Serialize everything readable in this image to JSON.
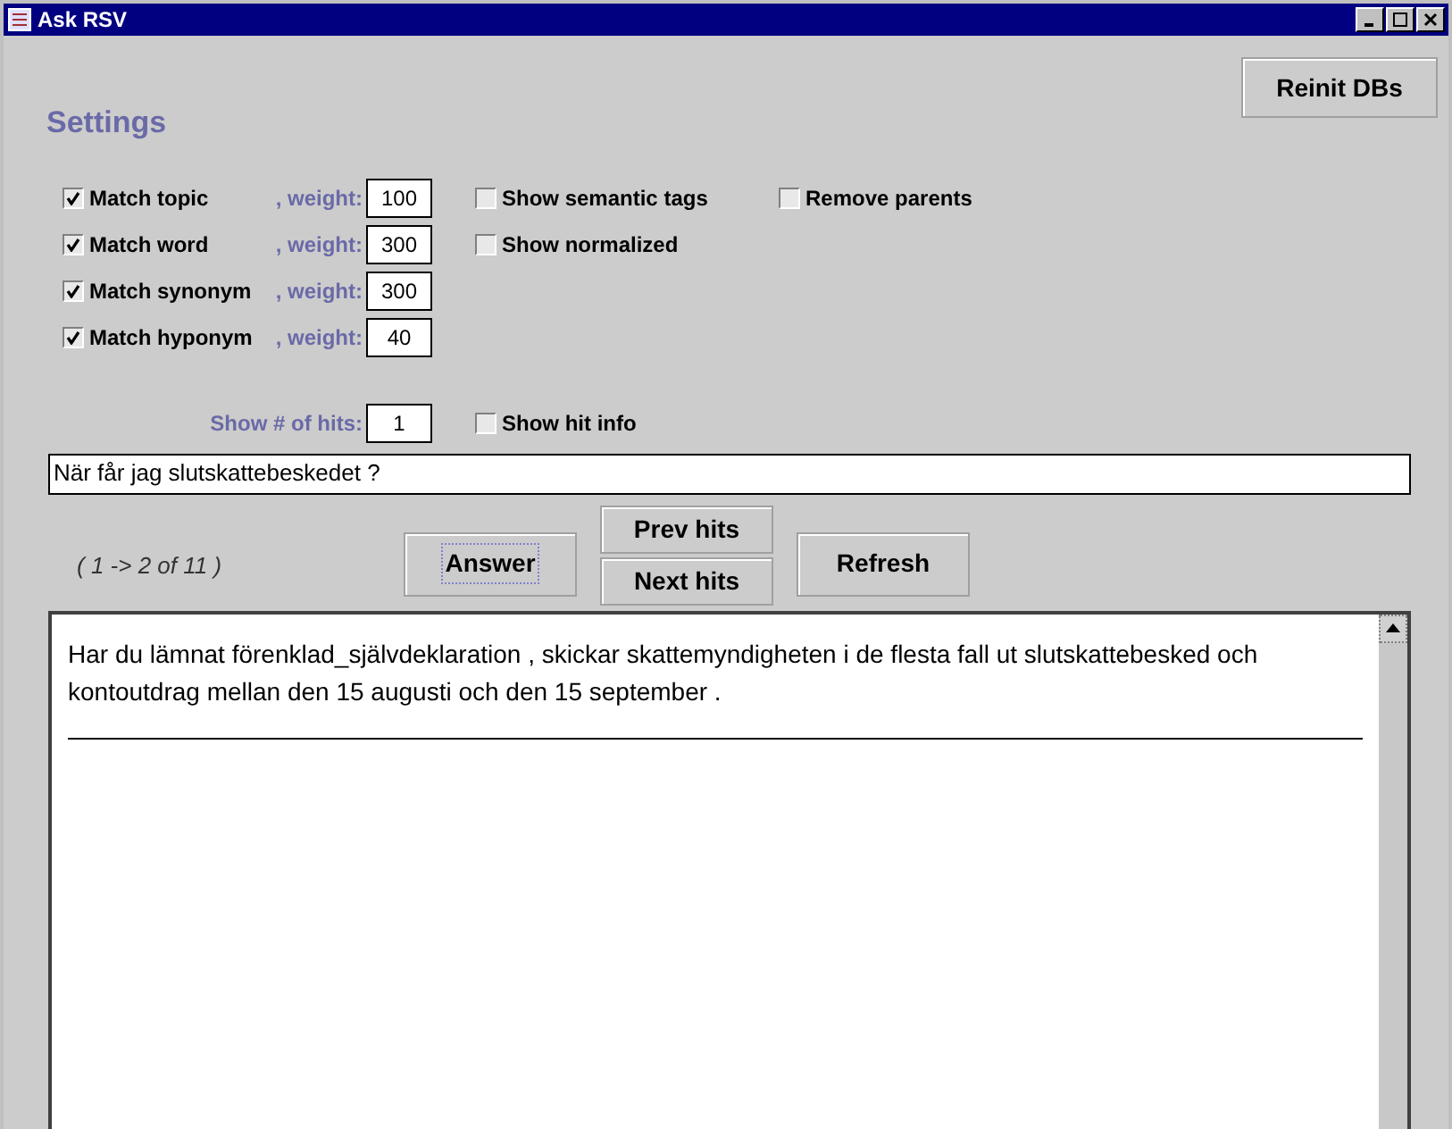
{
  "window": {
    "title": "Ask RSV"
  },
  "reinit_button": {
    "label": "Reinit DBs",
    "focused": false
  },
  "settings_title": "Settings",
  "rows": [
    {
      "match": {
        "label": "Match topic",
        "checked": true
      },
      "weight_label": ", weight:",
      "weight": "100",
      "options": [
        {
          "label": "Show semantic tags",
          "checked": false
        },
        {
          "label": "Remove parents",
          "checked": false
        }
      ]
    },
    {
      "match": {
        "label": "Match word",
        "checked": true
      },
      "weight_label": ", weight:",
      "weight": "300",
      "options": [
        {
          "label": "Show normalized",
          "checked": false
        }
      ]
    },
    {
      "match": {
        "label": "Match synonym",
        "checked": true
      },
      "weight_label": ", weight:",
      "weight": "300",
      "options": []
    },
    {
      "match": {
        "label": "Match hyponym",
        "checked": true
      },
      "weight_label": ", weight:",
      "weight": "40",
      "options": []
    }
  ],
  "hits": {
    "label": "Show # of hits:",
    "value": "1",
    "option": {
      "label": "Show hit info",
      "checked": false
    }
  },
  "query": {
    "value": "När får jag slutskattebeskedet ?"
  },
  "range": "( 1 -> 2 of 11 )",
  "answer_button": {
    "label": "Answer",
    "focused": true
  },
  "prev_button": {
    "label": "Prev hits",
    "focused": false
  },
  "next_button": {
    "label": "Next hits",
    "focused": false
  },
  "refresh_button": {
    "label": "Refresh",
    "focused": false
  },
  "answer_text": "Har du lämnat förenklad_självdeklaration , skickar skattemyndigheten i de flesta fall ut slutskattebesked och kontoutdrag mellan den 15 augusti och den 15 september ."
}
